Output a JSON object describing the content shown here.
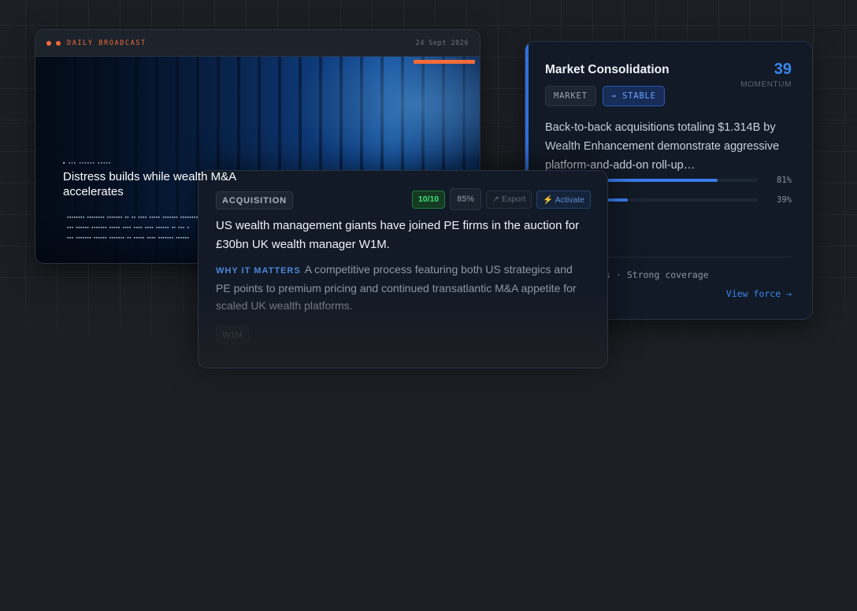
{
  "broadcast": {
    "title": "DAILY BROADCAST",
    "date": "24 Sept 2026",
    "headline": "Distress builds while wealth M&A accelerates",
    "colors": {
      "accent": "#f26b3a"
    }
  },
  "market_card": {
    "title": "Market Consolidation",
    "score": "39",
    "score_label": "MOMENTUM",
    "pill_market": "MARKET",
    "pill_stable": "→ STABLE",
    "description": "Back-to-back acquisitions totaling $1.314B by Wealth Enhancement demonstrate aggressive platform-and-add-on roll-up…",
    "bars": [
      {
        "value_label": "81%",
        "fraction": 0.81
      },
      {
        "value_label": "39%",
        "fraction": 0.39
      }
    ],
    "meta": "ls · 4 weeks · Strong coverage",
    "link": "View force →",
    "colors": {
      "accent": "#2f6fe0"
    }
  },
  "acquisition_card": {
    "badge": "ACQUISITION",
    "score": "10/10",
    "confidence": "85%",
    "export": "↗ Export",
    "activate": "⚡ Activate",
    "title": "US wealth management giants have joined PE firms in the auction for £30bn UK wealth manager W1M.",
    "why_label": "WHY IT MATTERS",
    "why_text": "A competitive process featuring both US strategics and PE points to premium pricing and continued transatlantic M&A appetite for scaled UK wealth platforms.",
    "tag": "W1M",
    "colors": {
      "score": "#3ee07a",
      "why": "#4d86d9"
    }
  }
}
